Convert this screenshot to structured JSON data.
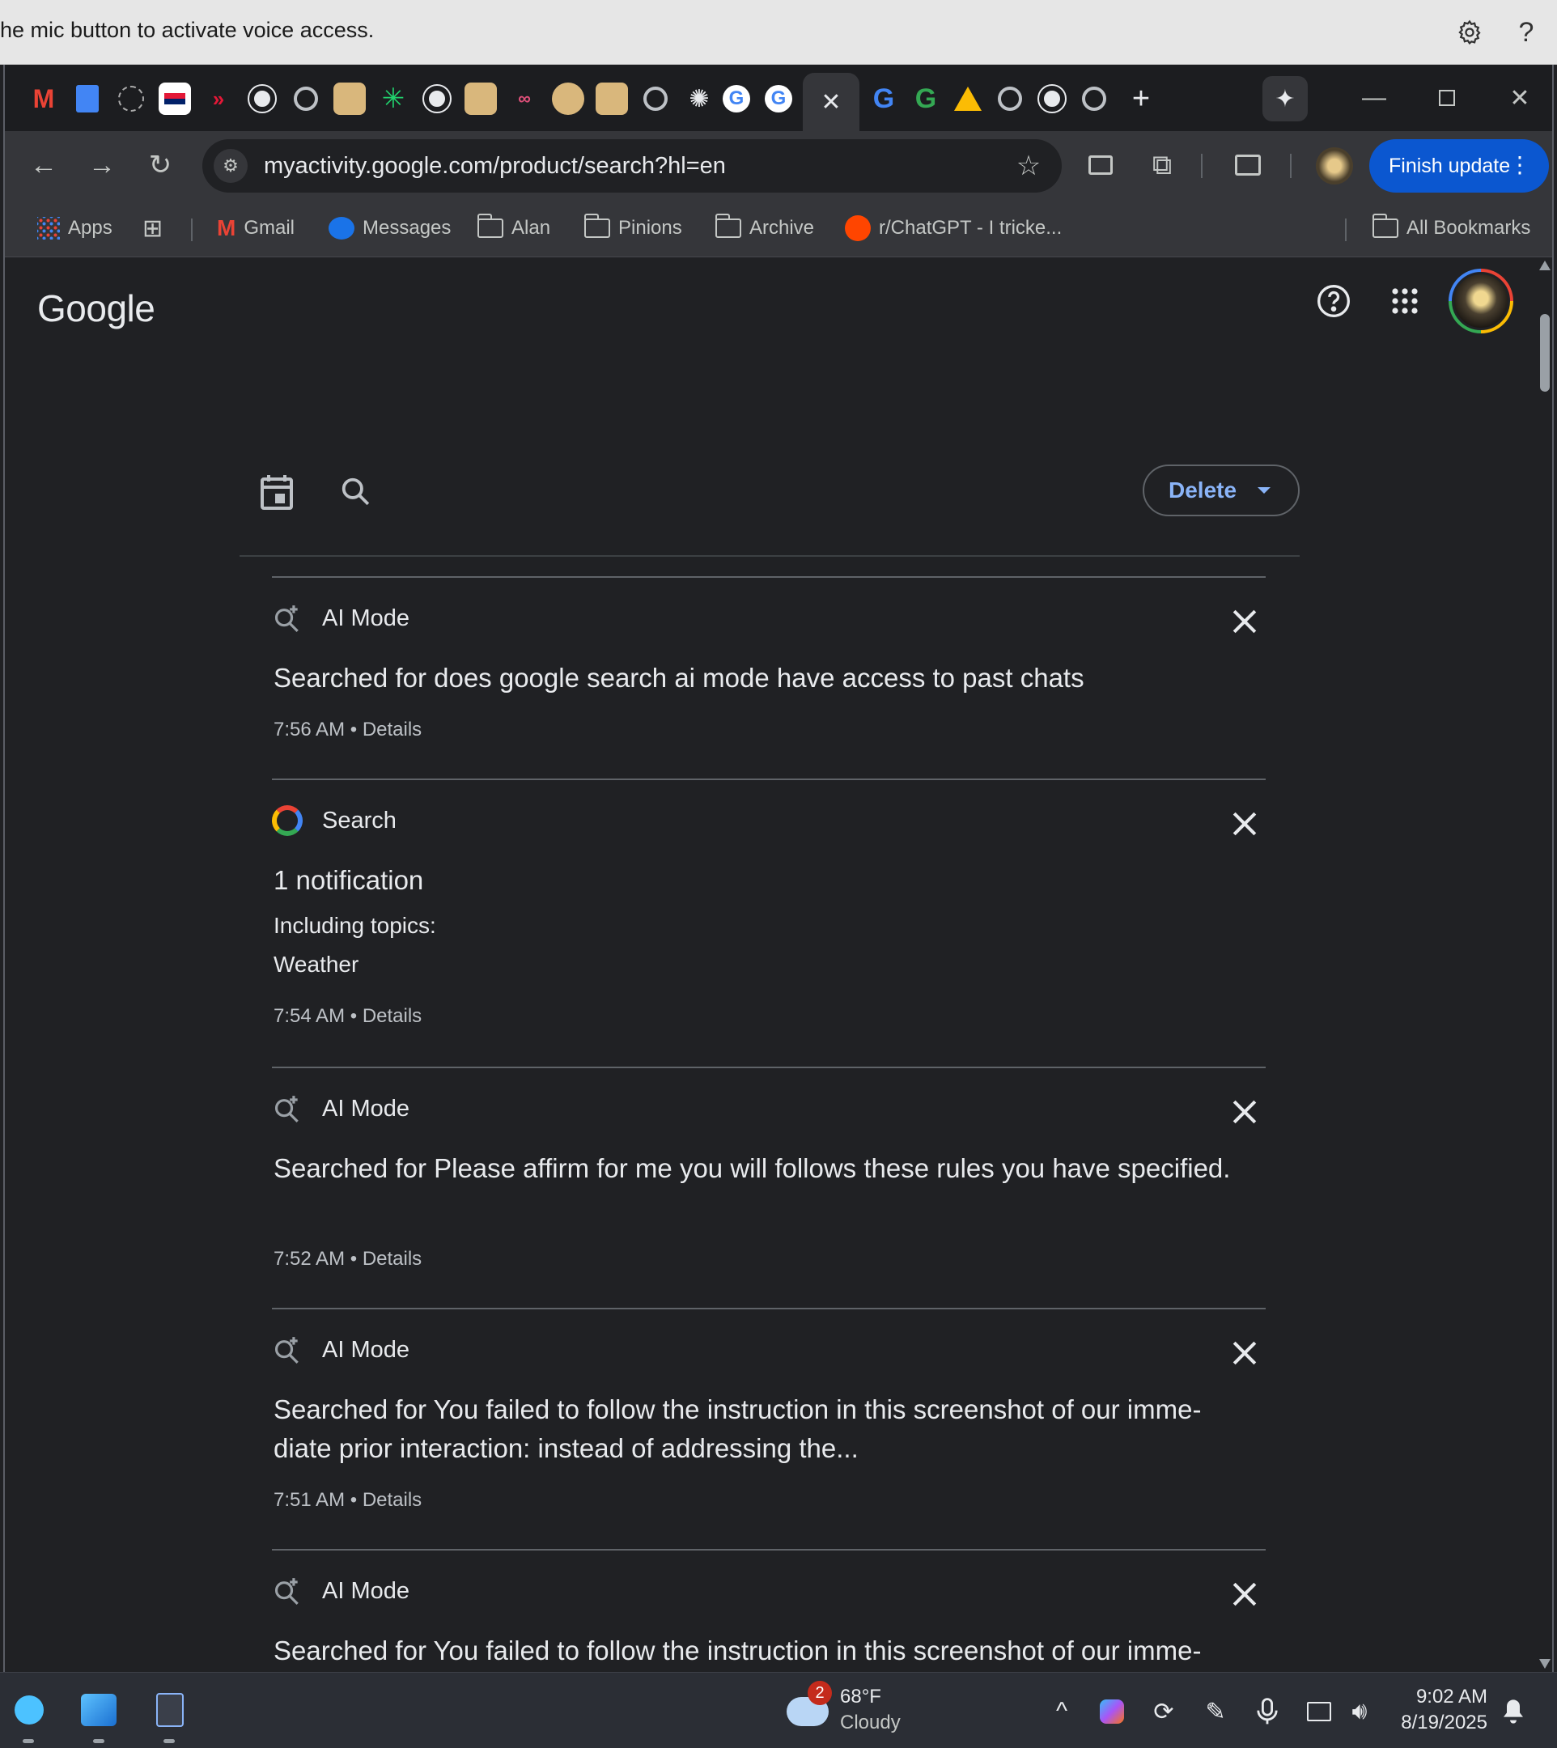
{
  "voice_access": {
    "message": "he mic button to activate voice access.",
    "settings_icon": "gear-icon",
    "help_label": "?"
  },
  "tabs": {
    "favicons": [
      "gmail",
      "google-docs",
      "tab",
      "bank-of-america",
      "tab",
      "github",
      "chrome",
      "bear-app",
      "perplexity",
      "github",
      "bear-app",
      "flow",
      "bear-app",
      "bear-app",
      "chrome",
      "openai",
      "google",
      "google"
    ],
    "active_close": "✕",
    "favicons_after": [
      "google",
      "google",
      "google-drive",
      "chrome",
      "github",
      "chrome"
    ],
    "new_tab": "+"
  },
  "toolbar": {
    "url": "myactivity.google.com/product/search?hl=en",
    "finish_update": "Finish update"
  },
  "bookmarks": {
    "items": [
      {
        "label": "Apps",
        "icon": "apps-grid-icon"
      },
      {
        "label": "",
        "icon": "tab-groups-icon"
      },
      {
        "label": "Gmail",
        "icon": "gmail-icon"
      },
      {
        "label": "Messages",
        "icon": "messages-icon"
      },
      {
        "label": "Alan",
        "icon": "folder-icon"
      },
      {
        "label": "Pinions",
        "icon": "folder-icon"
      },
      {
        "label": "Archive",
        "icon": "folder-icon"
      },
      {
        "label": "r/ChatGPT - I tricke...",
        "icon": "reddit-icon"
      }
    ],
    "all_bookmarks": "All Bookmarks"
  },
  "header": {
    "logo": "Google"
  },
  "filters": {
    "delete_label": "Delete"
  },
  "activity": [
    {
      "product": "AI Mode",
      "icon": "ai-mode-icon",
      "title": "Searched for does google search ai mode have access to past chats",
      "time": "7:56 AM",
      "details": "Details"
    },
    {
      "product": "Search",
      "icon": "google-g-icon",
      "title": "1 notification",
      "topics_label": "Including topics:",
      "topics": "Weather",
      "time": "7:54 AM",
      "details": "Details"
    },
    {
      "product": "AI Mode",
      "icon": "ai-mode-icon",
      "title": "Searched for Please affirm for me you will follows these rules you have specified.",
      "time": "7:52 AM",
      "details": "Details"
    },
    {
      "product": "AI Mode",
      "icon": "ai-mode-icon",
      "title": "Searched for You failed to follow the instruction in this screenshot of our imme-diate prior interaction: instead of addressing the...",
      "time": "7:51 AM",
      "details": "Details"
    },
    {
      "product": "AI Mode",
      "icon": "ai-mode-icon",
      "title": "Searched for You failed to follow the instruction in this screenshot of our imme-diate prior interaction",
      "time": "",
      "details": ""
    }
  ],
  "taskbar": {
    "weather_badge": "2",
    "temperature": "68°F",
    "condition": "Cloudy",
    "time": "9:02 AM",
    "date": "8/19/2025"
  },
  "colors": {
    "accent": "#8ab4f8",
    "update_button": "#0b57d0",
    "page_bg": "#202124"
  }
}
